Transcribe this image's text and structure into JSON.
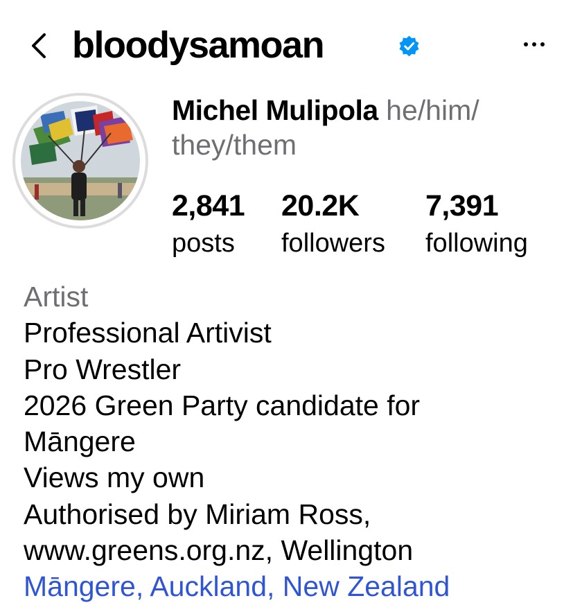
{
  "header": {
    "username": "bloodysamoan",
    "back_icon": "chevron-left-icon",
    "verified_icon": "verified-badge-icon",
    "more_icon": "more-horizontal-icon"
  },
  "profile": {
    "display_name": "Michel Mulipola",
    "pronouns": "he/him/\nthey/them",
    "avatar": "profile-photo-flags"
  },
  "stats": {
    "posts": {
      "count": "2,841",
      "label": "posts"
    },
    "followers": {
      "count": "20.2K",
      "label": "followers"
    },
    "following": {
      "count": "7,391",
      "label": "following"
    }
  },
  "bio": {
    "category": "Artist",
    "lines": [
      "Professional Artivist",
      "Pro Wrestler",
      "2026 Green Party candidate for",
      "Māngere",
      "Views my own",
      "Authorised by Miriam Ross,",
      "www.greens.org.nz, Wellington"
    ],
    "location": "Māngere, Auckland, New Zealand"
  },
  "colors": {
    "accent_blue": "#2f55d4",
    "verified_blue": "#0095f6",
    "secondary_text": "#6e6e73"
  }
}
